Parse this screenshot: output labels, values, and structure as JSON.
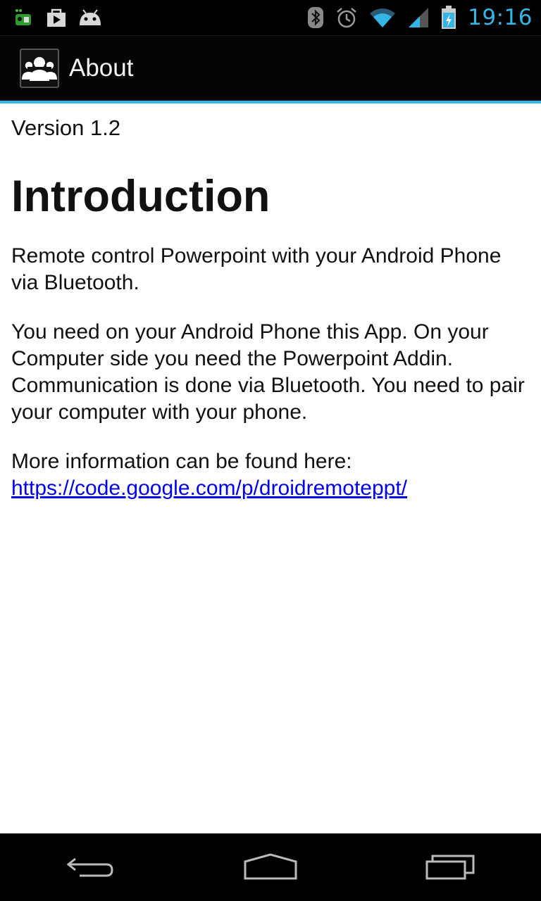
{
  "status_bar": {
    "time": "19:16",
    "left_icons": [
      "notification-app-icon",
      "play-store-icon",
      "android-debug-icon"
    ],
    "right_icons": [
      "bluetooth-icon",
      "alarm-icon",
      "wifi-icon",
      "cell-signal-icon",
      "battery-charging-icon"
    ],
    "clock_color": "#33b5e5"
  },
  "action_bar": {
    "title": "About",
    "icon": "people-group-icon",
    "accent_color": "#33b5e5"
  },
  "content": {
    "version": "Version 1.2",
    "heading": "Introduction",
    "paragraph1": "Remote control Powerpoint with your Android Phone via Bluetooth.",
    "paragraph2": "You need on your Android Phone this App. On your Computer side you need the Powerpoint Addin. Communication is done via Bluetooth. You need to pair your computer with your phone.",
    "paragraph3_prefix": "More information can be found here: ",
    "link_text": "https://code.google.com/p/droidremoteppt/"
  },
  "nav_bar": {
    "buttons": [
      "back-icon",
      "home-icon",
      "recent-apps-icon"
    ]
  }
}
